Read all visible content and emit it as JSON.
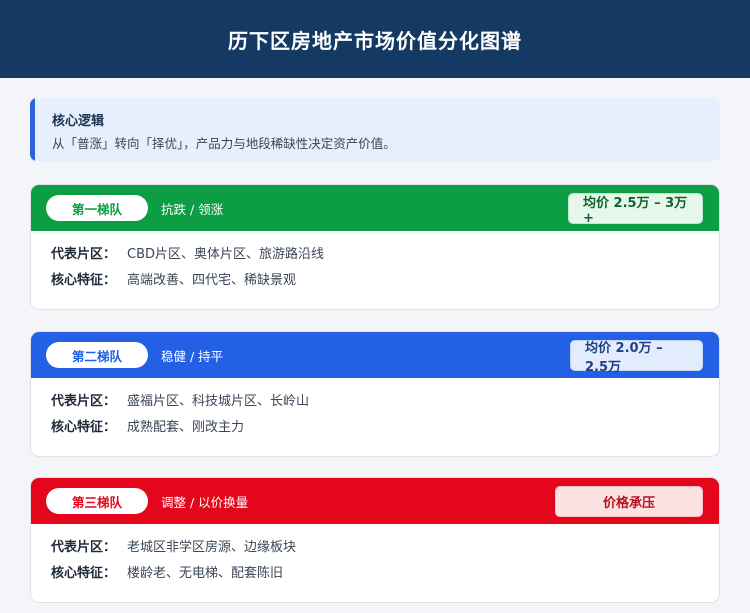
{
  "header": {
    "title": "历下区房地产市场价值分化图谱"
  },
  "logic": {
    "title": "核心逻辑",
    "desc": "从「普涨」转向「择优」，产品力与地段稀缺性决定资产价值。"
  },
  "tiers": [
    {
      "name": "第一梯队",
      "trend": "抗跌 / 领涨",
      "price": "均价 2.5万 – 3万+",
      "area_label": "代表片区：",
      "area": "CBD片区、奥体片区、旅游路沿线",
      "feature_label": "核心特征：",
      "feature": "高端改善、四代宅、稀缺景观",
      "color": "#0b9e43"
    },
    {
      "name": "第二梯队",
      "trend": "稳健 / 持平",
      "price": "均价 2.0万 – 2.5万",
      "area_label": "代表片区：",
      "area": "盛福片区、科技城片区、长岭山",
      "feature_label": "核心特征：",
      "feature": "成熟配套、刚改主力",
      "color": "#2360e6"
    },
    {
      "name": "第三梯队",
      "trend": "调整 / 以价换量",
      "price": "价格承压",
      "area_label": "代表片区：",
      "area": "老城区非学区房源、边缘板块",
      "feature_label": "核心特征：",
      "feature": "楼龄老、无电梯、配套陈旧",
      "color": "#e4061b"
    }
  ]
}
